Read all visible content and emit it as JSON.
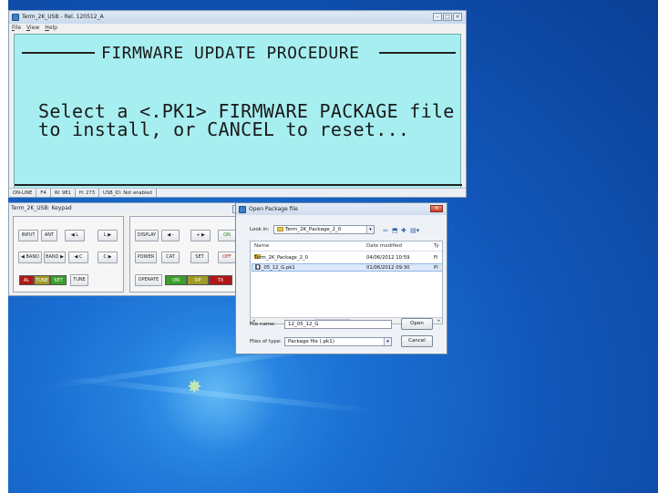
{
  "term_window": {
    "title": "Term_2K_USB - Rel. 120512_A",
    "menu": [
      "File",
      "View",
      "Help"
    ],
    "lcd": {
      "header": "FIRMWARE UPDATE PROCEDURE",
      "message": "Select a <.PK1> FIRMWARE PACKAGE file\nto install, or CANCEL to reset...",
      "bg_color": "#a7eef0"
    },
    "status": [
      "ON-LINE",
      "F4",
      "W: 981",
      "H: 273",
      "USB_ID: Not enabled"
    ]
  },
  "keypad": {
    "title": "Term_2K_USB: Keypad",
    "left_buttons": {
      "input": "INPUT",
      "ant": "ANT",
      "l_left": "◀ L",
      "l_right": "L ▶",
      "band_down": "◀ BAND",
      "band_up": "BAND ▶",
      "c_left": "◀ C",
      "c_right": "C ▶",
      "tune": "TUNE"
    },
    "left_leds": {
      "al": "AL",
      "tune": "TUNE",
      "set": "SET"
    },
    "right_buttons": {
      "display": "DISPLAY",
      "dec": "◀ -",
      "inc": "+ ▶",
      "on": "ON",
      "power": "POWER",
      "cat": "CAT",
      "set": "SET",
      "off": "OFF",
      "operate": "OPERATE"
    },
    "right_leds": {
      "on": "ON",
      "op": "OP",
      "tx": "TX"
    }
  },
  "dialog": {
    "title": "Open Package file",
    "look_in_label": "Look in:",
    "look_in_value": "Term_2K_Package_2_0",
    "columns": {
      "name": "Name",
      "date": "Date modified",
      "type": "Ty"
    },
    "files": [
      {
        "name": "Term_2K_Package_2_0",
        "date": "04/06/2012 10:59",
        "type": "Fi",
        "kind": "folder"
      },
      {
        "name": "12_05_12_G.pk1",
        "date": "01/06/2012 09:30",
        "type": "Pl",
        "kind": "file"
      }
    ],
    "file_name_label": "File name:",
    "file_name_value": "12_05_12_G",
    "files_of_type_label": "Files of type:",
    "files_of_type_value": "Package file (.pk1)",
    "open_label": "Open",
    "cancel_label": "Cancel"
  },
  "colors": {
    "led_red": "#b01818",
    "led_green": "#3aa02a",
    "led_olive": "#a09a28",
    "lcd_bg": "#a7eef0"
  }
}
